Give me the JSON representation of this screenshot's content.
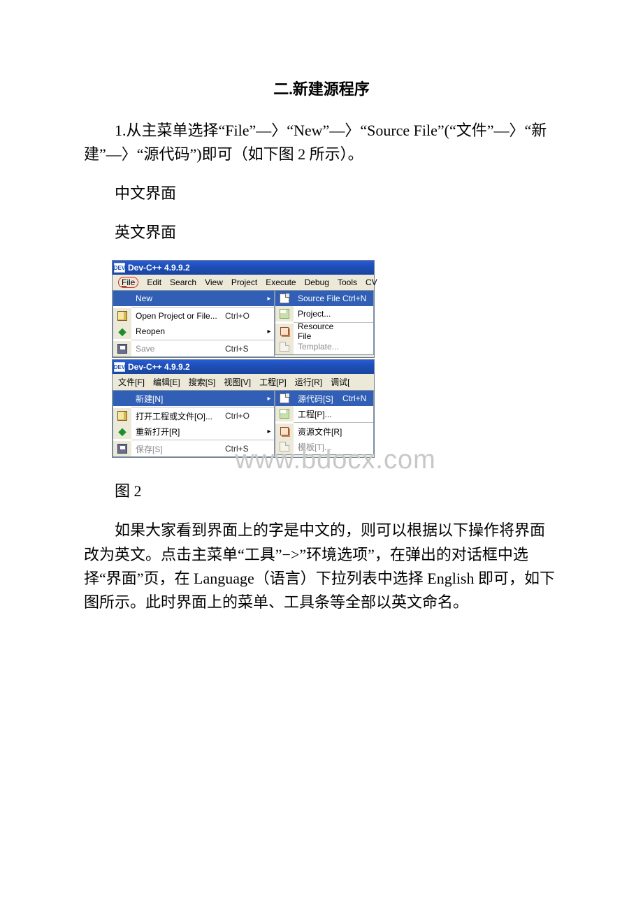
{
  "title": "二.新建源程序",
  "para1": "1.从主菜单选择“File”—〉“New”—〉“Source File”(“文件”—〉“新建”—〉“源代码”)即可（如下图 2 所示）。",
  "label_cn_ui": "中文界面",
  "label_en_ui": "英文界面",
  "fig_caption": "图 2",
  "para2": "如果大家看到界面上的字是中文的，则可以根据以下操作将界面改为英文。点击主菜单“工具”−>”环境选项”，在弹出的对话框中选择“界面”页，在 Language（语言）下拉列表中选择 English 即可，如下图所示。此时界面上的菜单、工具条等全部以英文命名。",
  "watermark": "www.bdocx.com",
  "app_title": "Dev-C++ 4.9.9.2",
  "en": {
    "menu": [
      "File",
      "Edit",
      "Search",
      "View",
      "Project",
      "Execute",
      "Debug",
      "Tools",
      "CV"
    ],
    "file_items": [
      {
        "label": "New",
        "accel": "",
        "arrow": true,
        "selected": true
      },
      {
        "label": "Open Project or File...",
        "accel": "Ctrl+O"
      },
      {
        "label": "Reopen",
        "accel": "",
        "arrow": true
      },
      {
        "label": "Save",
        "accel": "Ctrl+S",
        "disabled": true
      }
    ],
    "new_items": [
      {
        "label": "Source File",
        "accel": "Ctrl+N",
        "selected": true
      },
      {
        "label": "Project..."
      },
      {
        "label": "Resource File"
      },
      {
        "label": "Template...",
        "disabled": true
      }
    ]
  },
  "cn": {
    "menu": [
      "文件[F]",
      "编辑[E]",
      "搜索[S]",
      "视图[V]",
      "工程[P]",
      "运行[R]",
      "调试["
    ],
    "file_items": [
      {
        "label": "新建[N]",
        "accel": "",
        "arrow": true,
        "selected": true
      },
      {
        "label": "打开工程或文件[O]...",
        "accel": "Ctrl+O"
      },
      {
        "label": "重新打开[R]",
        "accel": "",
        "arrow": true
      },
      {
        "label": "保存[S]",
        "accel": "Ctrl+S",
        "disabled": true
      }
    ],
    "new_items": [
      {
        "label": "源代码[S]",
        "accel": "Ctrl+N",
        "selected": true
      },
      {
        "label": "工程[P]..."
      },
      {
        "label": "资源文件[R]"
      },
      {
        "label": "模板[T]...",
        "disabled": true
      }
    ]
  }
}
